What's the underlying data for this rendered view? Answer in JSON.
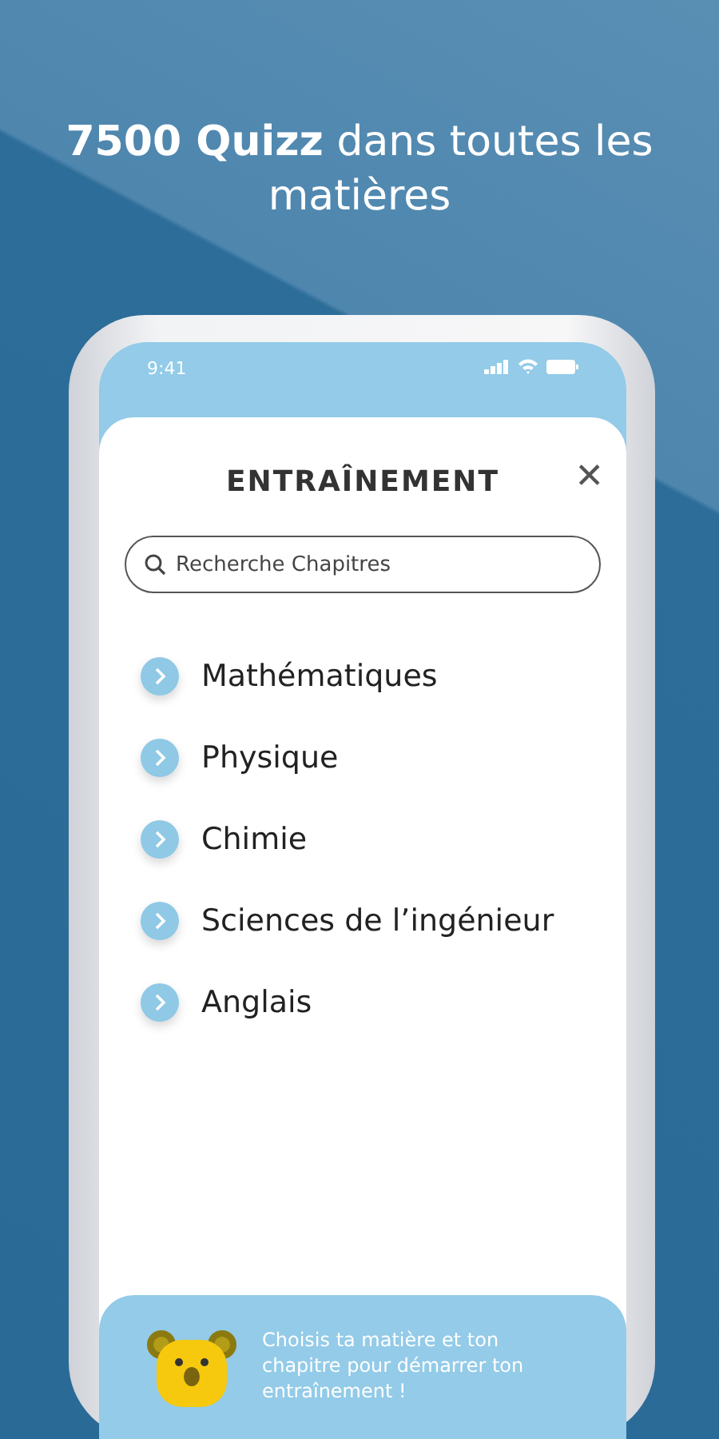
{
  "headline": "**7500 Quizz** dans toutes les matières",
  "status_bar": {
    "time": "9:41"
  },
  "title": "ENTRAÎNEMENT",
  "close": "✕",
  "search": {
    "placeholder": "Recherche Chapitres"
  },
  "subjects": [
    {
      "label": "Mathématiques"
    },
    {
      "label": "Physique"
    },
    {
      "label": "Chimie"
    },
    {
      "label": "Sciences de l’ingénieur"
    },
    {
      "label": "Anglais"
    }
  ],
  "banner": {
    "text": "Choisis ta matière et ton chapitre pour démarrer ton entraînement !"
  }
}
